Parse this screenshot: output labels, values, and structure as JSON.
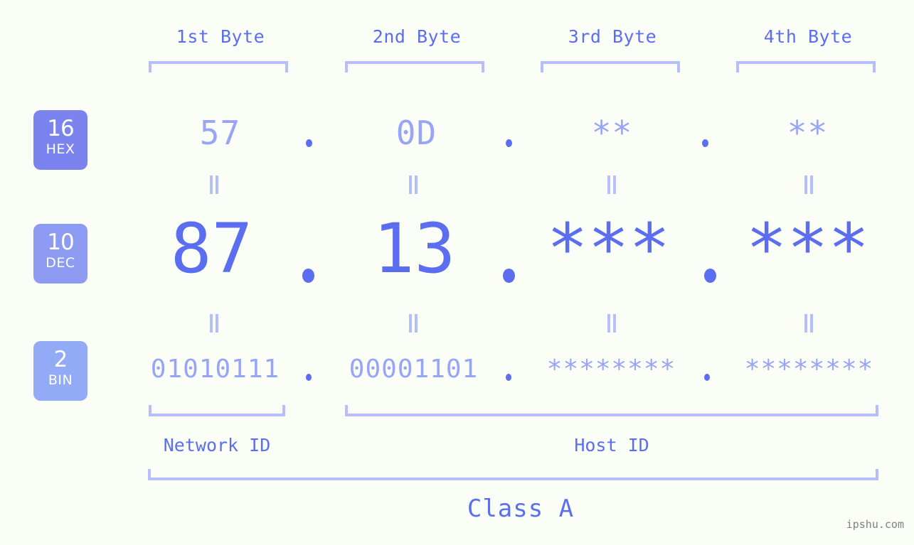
{
  "headers": [
    {
      "label": "1st Byte"
    },
    {
      "label": "2nd Byte"
    },
    {
      "label": "3rd Byte"
    },
    {
      "label": "4th Byte"
    }
  ],
  "bases": [
    {
      "number": "16",
      "abbr": "HEX"
    },
    {
      "number": "10",
      "abbr": "DEC"
    },
    {
      "number": "2",
      "abbr": "BIN"
    }
  ],
  "rows": {
    "hex": {
      "base": "16",
      "abbr": "HEX",
      "values": [
        "57",
        "0D",
        "**",
        "**"
      ],
      "separator": "."
    },
    "dec": {
      "base": "10",
      "abbr": "DEC",
      "values": [
        "87",
        "13",
        "***",
        "***"
      ],
      "separator": "."
    },
    "bin": {
      "base": "2",
      "abbr": "BIN",
      "values": [
        "01010111",
        "00001101",
        "********",
        "********"
      ],
      "separator": "."
    }
  },
  "connector": "||",
  "segments": {
    "network_id": "Network ID",
    "host_id": "Host ID",
    "class": "Class A"
  },
  "watermark": "ipshu.com",
  "colors": {
    "background": "#fbfdf7",
    "accent_strong": "#5b6ef0",
    "accent_mid": "#97a5f7",
    "accent_light": "#b5c0fb",
    "badge_hex": "#7b84ee",
    "badge_dec": "#8e9bf3",
    "badge_bin": "#93aaf6",
    "watermark": "#808080"
  }
}
